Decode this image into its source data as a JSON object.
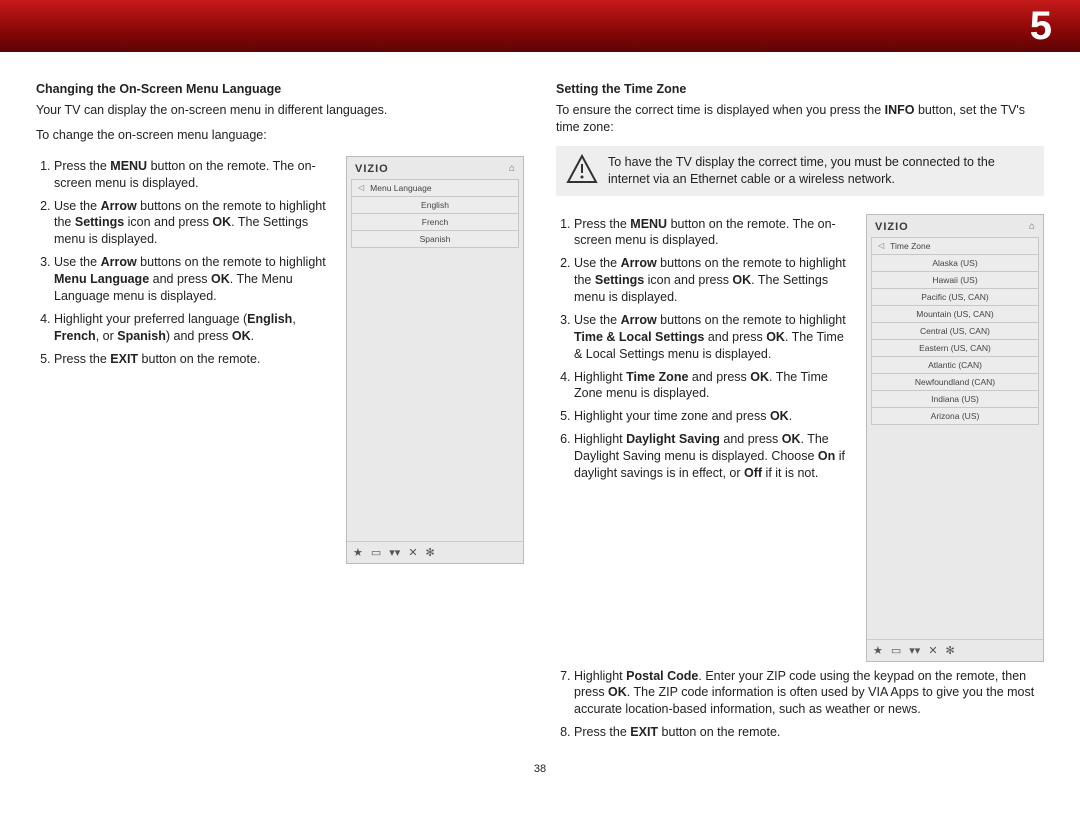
{
  "chapter_number": "5",
  "page_number": "38",
  "left": {
    "heading": "Changing the On-Screen Menu Language",
    "intro": "Your TV can display the on-screen menu in different languages.",
    "lead": "To change the on-screen menu language:",
    "step1_a": "Press the ",
    "step1_b": "MENU",
    "step1_c": " button on the remote. The on-screen menu is displayed.",
    "step2_a": "Use the ",
    "step2_b": "Arrow",
    "step2_c": " buttons on the remote to highlight the ",
    "step2_d": "Settings",
    "step2_e": " icon and press ",
    "step2_f": "OK",
    "step2_g": ". The Settings menu is displayed.",
    "step3_a": "Use the ",
    "step3_b": "Arrow",
    "step3_c": " buttons on the remote to highlight ",
    "step3_d": "Menu Language",
    "step3_e": " and press ",
    "step3_f": "OK",
    "step3_g": ". The Menu Language menu is displayed.",
    "step4_a": "Highlight your preferred language (",
    "step4_b": "English",
    "step4_c": ", ",
    "step4_d": "French",
    "step4_e": ", or ",
    "step4_f": "Spanish",
    "step4_g": ") and press ",
    "step4_h": "OK",
    "step4_i": ".",
    "step5_a": "Press the ",
    "step5_b": "EXIT",
    "step5_c": " button on the remote.",
    "mock": {
      "logo": "VIZIO",
      "title": "Menu Language",
      "items": [
        "English",
        "French",
        "Spanish"
      ]
    }
  },
  "right": {
    "heading": "Setting the Time Zone",
    "intro_a": "To ensure the correct time is displayed when you press the ",
    "intro_b": "INFO",
    "intro_c": " button, set the TV's time zone:",
    "note": "To have the TV display the correct time, you must be connected to the internet via an Ethernet cable or a wireless network.",
    "step1_a": "Press the ",
    "step1_b": "MENU",
    "step1_c": " button on the remote. The on-screen menu is displayed.",
    "step2_a": "Use the ",
    "step2_b": "Arrow",
    "step2_c": " buttons on the remote to highlight the ",
    "step2_d": "Settings",
    "step2_e": " icon and press ",
    "step2_f": "OK",
    "step2_g": ". The Settings menu is displayed.",
    "step3_a": "Use the ",
    "step3_b": "Arrow",
    "step3_c": " buttons on the remote to highlight ",
    "step3_d": "Time & Local Settings",
    "step3_e": " and press ",
    "step3_f": "OK",
    "step3_g": ". The Time & Local Settings menu is displayed.",
    "step4_a": "Highlight ",
    "step4_b": "Time Zone",
    "step4_c": " and press ",
    "step4_d": "OK",
    "step4_e": ". The Time Zone menu is displayed.",
    "step5_a": "Highlight your time zone and press ",
    "step5_b": "OK",
    "step5_c": ".",
    "step6_a": "Highlight ",
    "step6_b": "Daylight Saving",
    "step6_c": " and press ",
    "step6_d": "OK",
    "step6_e": ". The Daylight Saving menu is displayed. Choose ",
    "step6_f": "On",
    "step6_g": " if daylight savings is in effect, or ",
    "step6_h": "Off",
    "step6_i": " if it is not.",
    "step7_a": "Highlight ",
    "step7_b": "Postal Code",
    "step7_c": ". Enter your ZIP code using the keypad on the remote, then press ",
    "step7_d": "OK",
    "step7_e": ". The ZIP code information is often used by VIA Apps to give you the most accurate location-based information, such as weather or news.",
    "step8_a": "Press the ",
    "step8_b": "EXIT",
    "step8_c": " button on the remote.",
    "mock": {
      "logo": "VIZIO",
      "title": "Time Zone",
      "items": [
        "Alaska (US)",
        "Hawaii (US)",
        "Pacific (US, CAN)",
        "Mountain (US, CAN)",
        "Central (US, CAN)",
        "Eastern (US, CAN)",
        "Atlantic (CAN)",
        "Newfoundland (CAN)",
        "Indiana (US)",
        "Arizona (US)"
      ]
    }
  },
  "icons": {
    "star": "★",
    "wide": "⌂",
    "v": "V",
    "x": "✕",
    "gear": "✻",
    "home": "⌂"
  }
}
